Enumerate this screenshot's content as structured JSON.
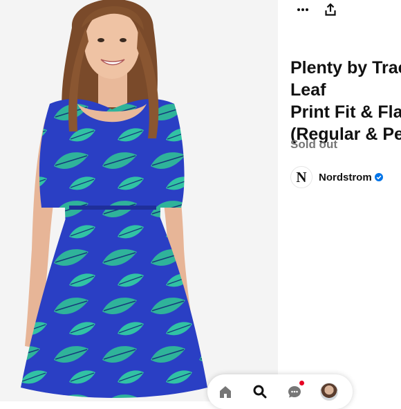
{
  "product": {
    "title": "Plenty by Tracy Reese Leaf\nPrint Fit & Flare Dress\n(Regular & Petite)",
    "status": "Sold out"
  },
  "merchant": {
    "logo_letter": "N",
    "name": "Nordstrom",
    "verified": true
  },
  "toolbar": {
    "icons": [
      "more-icon",
      "share-icon"
    ]
  },
  "navbar": {
    "items": [
      "home-icon",
      "search-icon",
      "messages-icon",
      "profile-avatar"
    ],
    "messages_has_notification": true
  },
  "colors": {
    "dress_blue": "#2a3fc4",
    "leaf_teal": "#2fb39a",
    "notification_red": "#e60023",
    "verified_blue": "#0074e8",
    "status_gray": "#767676"
  }
}
